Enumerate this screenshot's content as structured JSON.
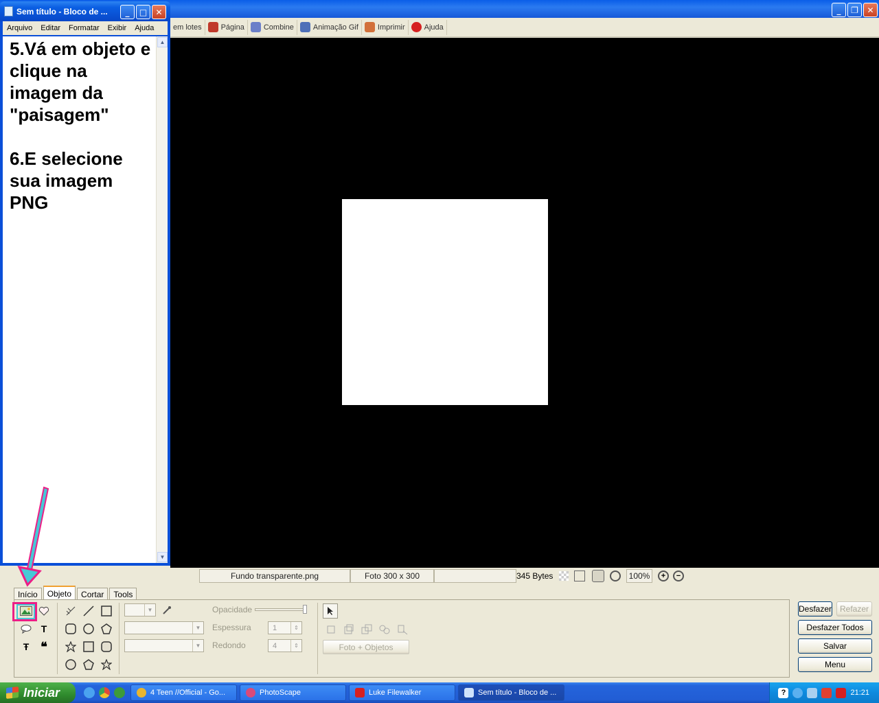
{
  "photoscape": {
    "toolbar": [
      {
        "label": "em lotes",
        "icon": "batch-icon",
        "color": ""
      },
      {
        "label": "Página",
        "icon": "page-icon",
        "color": "#c0392b"
      },
      {
        "label": "Combine",
        "icon": "combine-icon",
        "color": "#6b7fc9"
      },
      {
        "label": "Animação Gif",
        "icon": "gif-icon",
        "color": "#4e6fb8"
      },
      {
        "label": "Imprimir",
        "icon": "print-icon",
        "color": "#d2703a"
      },
      {
        "label": "Ajuda",
        "icon": "help-icon",
        "color": "#d62020"
      }
    ],
    "status": {
      "filename": "Fundo transparente.png",
      "photo_size": "Foto 300 x 300",
      "bytes": "345 Bytes",
      "zoom": "100%"
    },
    "tabs": [
      "Início",
      "Objeto",
      "Cortar",
      "Tools"
    ],
    "active_tab": "Objeto",
    "object_panel": {
      "opacity_label": "Opacidade",
      "thickness_label": "Espessura",
      "thickness_value": "1",
      "round_label": "Redondo",
      "round_value": "4",
      "photo_objects_button": "Foto + Objetos"
    },
    "right_buttons": {
      "undo": "Desfazer",
      "redo": "Refazer",
      "undo_all": "Desfazer Todos",
      "save": "Salvar",
      "menu": "Menu"
    }
  },
  "notepad": {
    "title": "Sem título - Bloco de ...",
    "menu": [
      "Arquivo",
      "Editar",
      "Formatar",
      "Exibir",
      "Ajuda"
    ],
    "text": "5.Vá em objeto e clique na imagem da \"paisagem\"\n\n6.E selecione sua imagem PNG"
  },
  "taskbar": {
    "start": "Iniciar",
    "tasks": [
      {
        "label": "4 Teen //Official - Go...",
        "icon_color": "#e8b530"
      },
      {
        "label": "PhotoScape",
        "icon_color": "#d94a7a"
      },
      {
        "label": "Luke Filewalker",
        "icon_color": "#d62020"
      },
      {
        "label": "Sem título - Bloco de ...",
        "icon_color": "#cfe3fb"
      }
    ],
    "clock": "21:21"
  },
  "colors": {
    "annotation_pink": "#ec1e86",
    "annotation_cyan": "#46c9d6"
  }
}
